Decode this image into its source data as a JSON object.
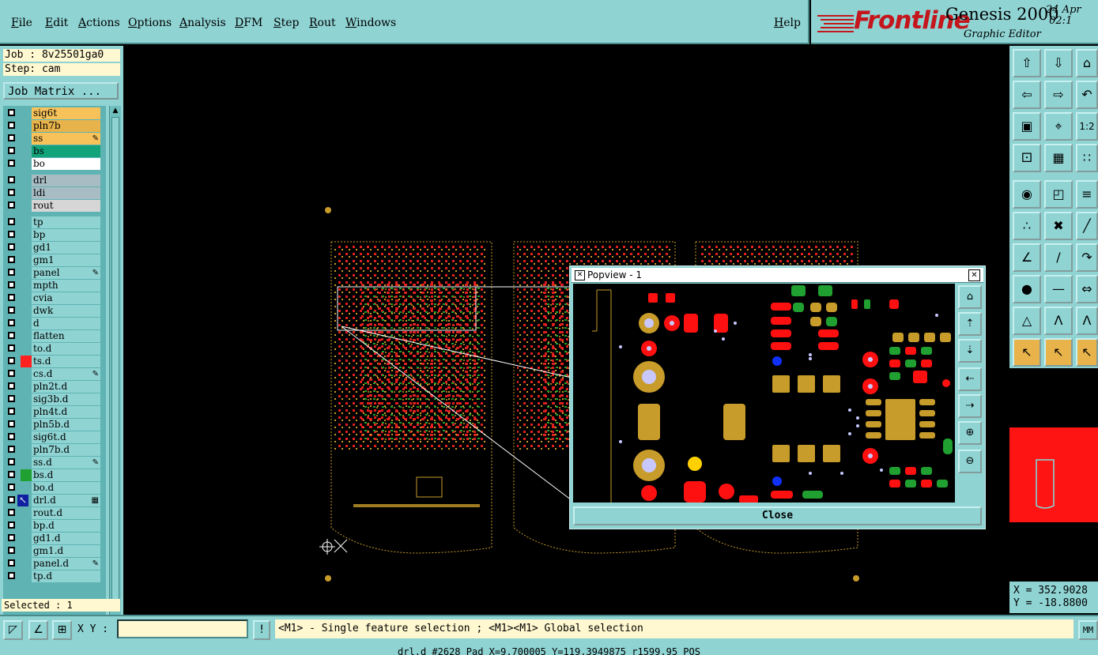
{
  "menu": [
    "File",
    "Edit",
    "Actions",
    "Options",
    "Analysis",
    "DFM",
    "Step",
    "Rout",
    "Windows"
  ],
  "help_label": "Help",
  "brand": {
    "logo": "Frontline",
    "product": "Genesis 2000",
    "subtitle": "Graphic Editor",
    "date_line1": "24 Apr",
    "date_line2": "02:1"
  },
  "job": "Job : 8v25501ga0",
  "step": "Step: cam",
  "job_matrix_label": "Job Matrix ...",
  "layers": [
    {
      "name": "sig6t",
      "bg": "#f7c25a",
      "swatch": ""
    },
    {
      "name": "pln7b",
      "bg": "#e8b34a",
      "swatch": ""
    },
    {
      "name": "ss",
      "bg": "#f7c25a",
      "swatch": "",
      "flag": "✎"
    },
    {
      "name": "bs",
      "bg": "#12a37a",
      "swatch": ""
    },
    {
      "name": "bo",
      "bg": "#ffffff",
      "swatch": ""
    },
    {
      "gap": true
    },
    {
      "name": "drl",
      "bg": "#a8bcc4",
      "swatch": ""
    },
    {
      "name": "ldi",
      "bg": "#a8bcc4",
      "swatch": ""
    },
    {
      "name": "rout",
      "bg": "#d6d6d6",
      "swatch": ""
    },
    {
      "gap": true
    },
    {
      "name": "tp",
      "bg": "#8fd3d3",
      "swatch": ""
    },
    {
      "name": "bp",
      "bg": "#8fd3d3",
      "swatch": ""
    },
    {
      "name": "gd1",
      "bg": "#8fd3d3",
      "swatch": ""
    },
    {
      "name": "gm1",
      "bg": "#8fd3d3",
      "swatch": ""
    },
    {
      "name": "panel",
      "bg": "#8fd3d3",
      "swatch": "",
      "flag": "✎"
    },
    {
      "name": "mpth",
      "bg": "#8fd3d3",
      "swatch": ""
    },
    {
      "name": "cvia",
      "bg": "#8fd3d3",
      "swatch": ""
    },
    {
      "name": "dwk",
      "bg": "#8fd3d3",
      "swatch": ""
    },
    {
      "name": "d",
      "bg": "#8fd3d3",
      "swatch": ""
    },
    {
      "name": "flatten",
      "bg": "#8fd3d3",
      "swatch": ""
    },
    {
      "name": "to.d",
      "bg": "#8fd3d3",
      "swatch": ""
    },
    {
      "name": "ts.d",
      "bg": "#8fd3d3",
      "swatch": "#ff2020"
    },
    {
      "name": "cs.d",
      "bg": "#8fd3d3",
      "swatch": "",
      "flag": "✎"
    },
    {
      "name": "pln2t.d",
      "bg": "#8fd3d3",
      "swatch": ""
    },
    {
      "name": "sig3b.d",
      "bg": "#8fd3d3",
      "swatch": ""
    },
    {
      "name": "pln4t.d",
      "bg": "#8fd3d3",
      "swatch": ""
    },
    {
      "name": "pln5b.d",
      "bg": "#8fd3d3",
      "swatch": ""
    },
    {
      "name": "sig6t.d",
      "bg": "#8fd3d3",
      "swatch": ""
    },
    {
      "name": "pln7b.d",
      "bg": "#8fd3d3",
      "swatch": ""
    },
    {
      "name": "ss.d",
      "bg": "#8fd3d3",
      "swatch": "",
      "flag": "✎"
    },
    {
      "name": "bs.d",
      "bg": "#8fd3d3",
      "swatch": "#20a030"
    },
    {
      "name": "bo.d",
      "bg": "#8fd3d3",
      "swatch": ""
    },
    {
      "name": "drl.d",
      "bg": "#8fd3d3",
      "swatch": "#1020a0",
      "flag": "▦",
      "active": true
    },
    {
      "name": "rout.d",
      "bg": "#8fd3d3",
      "swatch": ""
    },
    {
      "name": "bp.d",
      "bg": "#8fd3d3",
      "swatch": ""
    },
    {
      "name": "gd1.d",
      "bg": "#8fd3d3",
      "swatch": ""
    },
    {
      "name": "gm1.d",
      "bg": "#8fd3d3",
      "swatch": ""
    },
    {
      "name": "panel.d",
      "bg": "#8fd3d3",
      "swatch": "",
      "flag": "✎"
    },
    {
      "name": "tp.d",
      "bg": "#8fd3d3",
      "swatch": ""
    }
  ],
  "selected": "Selected : 1",
  "popview": {
    "title": "Popview - 1",
    "close_label": "Close"
  },
  "coords": {
    "x": "X = 352.9028",
    "y": "Y = -18.8800"
  },
  "xy_label": "X Y :",
  "message": "<M1> - Single feature selection ; <M1><M1> Global selection",
  "units_label": "MM",
  "status_line": "drl.d #2628 Pad X=9.700005 Y=119.3949875 r1599.95 POS",
  "icons": {
    "right_toolbar": [
      "zoom-top-icon",
      "zoom-bottom-icon",
      "home-icon",
      "pan-left-icon",
      "pan-right-icon",
      "undo-pan-icon",
      "zoom-fit-icon",
      "zoom-center-icon",
      "scale-1-2-icon",
      "snap-icon",
      "grid-icon",
      "network-icon",
      "select-pad-icon",
      "draw-box-icon",
      "ruler-icon",
      "connect-icon",
      "cross-icon",
      "line-pick-icon",
      "angle-icon",
      "slash-line-icon",
      "arc-icon",
      "point-icon",
      "dash-line-icon",
      "dimension-icon",
      "triangle-icon",
      "a-cap-icon",
      "a-bar-icon",
      "pointer-icon",
      "pointer-box-icon",
      "pointer-alt-icon"
    ]
  }
}
